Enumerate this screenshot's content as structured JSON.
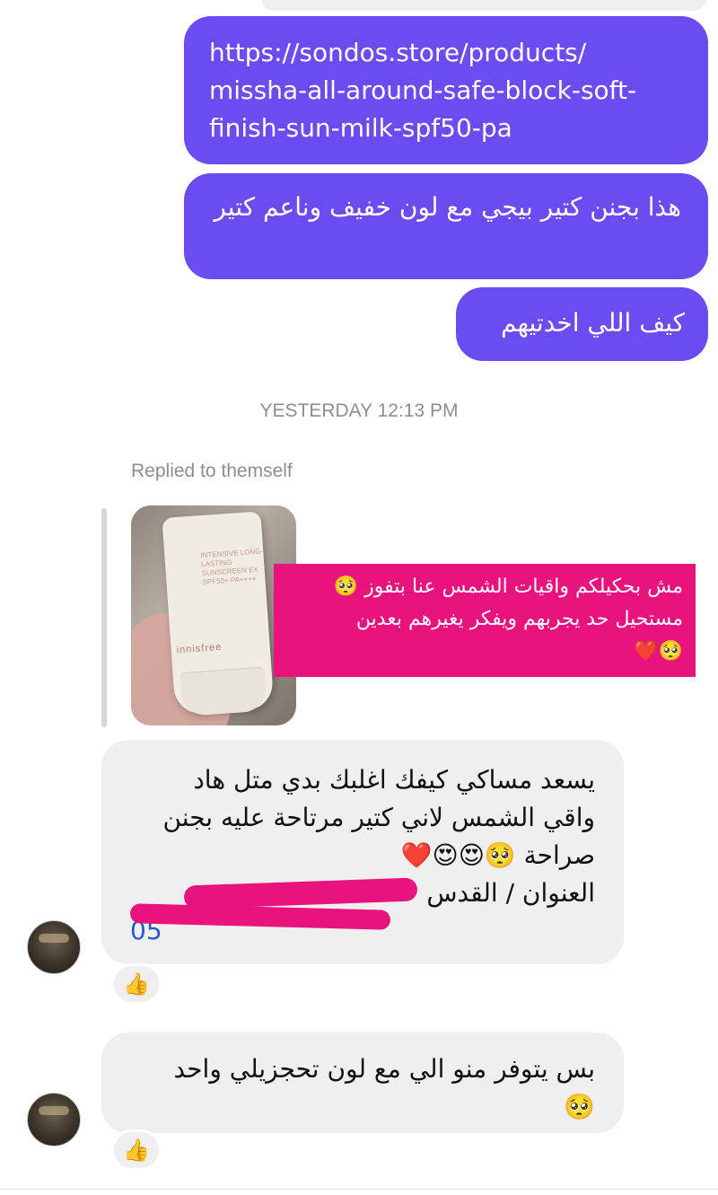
{
  "conversation": {
    "sent_messages": {
      "url_lines": [
        "https://sondos.store/products/",
        "missha-all-around-safe-block-soft-",
        "finish-sun-milk-spf50-pa"
      ],
      "message_2": "هذا بجنن كتير بيجي مع لون خفيف وناعم كتير",
      "message_3": "كيف اللي اخدتيهم"
    },
    "timestamp": "YESTERDAY 12:13 PM",
    "replied_label": "Replied to themself",
    "story": {
      "product_brand": "innisfree",
      "product_text": "INTENSIVE LONG-LASTING SUNSCREEN EX SPF50+ PA++++",
      "overlay_line_1": "مش بحكيلكم واقيات الشمس عنا بتفوز 🥺",
      "overlay_line_2": "مستحيل حد يجربهم ويفكر يغيرهم بعدين",
      "overlay_line_3": "🥺❤️"
    },
    "received_messages": {
      "message_1_lines": [
        "يسعد مساكي كيفك اغلبك بدي متل هاد",
        "واقي الشمس لاني كتير مرتاحة عليه بجنن",
        "صراحة 🥺😍😍❤️"
      ],
      "address_label": "العنوان / القدس",
      "phone_prefix": "05",
      "message_2_lines": [
        "بس يتوفر منو الي مع لون تحجزيلي واحد",
        "🥺"
      ],
      "reaction_1": "👍",
      "reaction_2": "👍"
    }
  },
  "colors": {
    "sent_bubble": "#6b4cf0",
    "received_bubble": "#efefef",
    "story_overlay": "#e8137d",
    "meta_text": "#8e8e8e"
  }
}
